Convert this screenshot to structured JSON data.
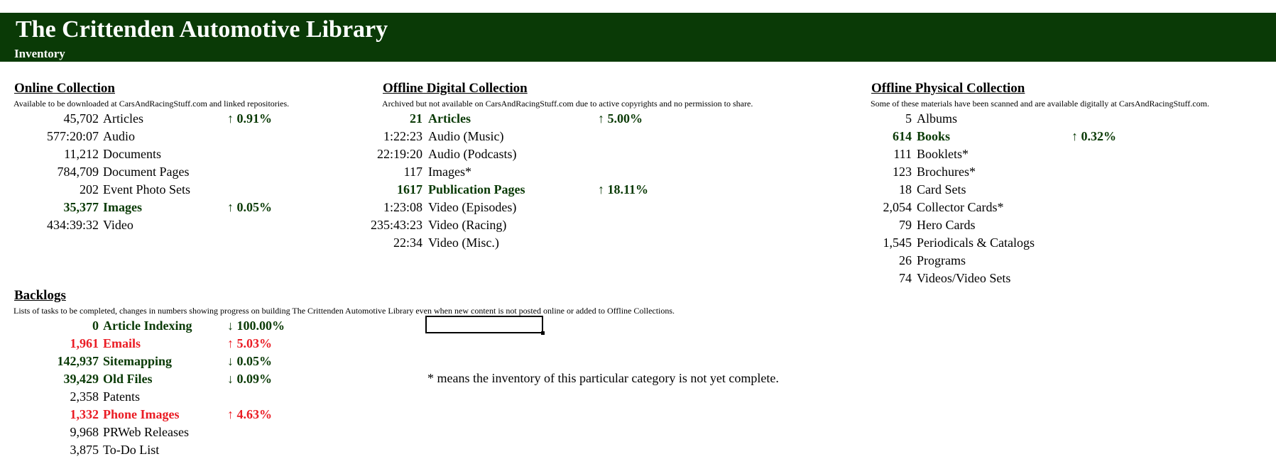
{
  "header": {
    "title": "The Crittenden Automotive Library",
    "subtitle": "Inventory"
  },
  "colors": {
    "banner": "#0a3a06",
    "accent_green": "#0a3a06",
    "alert_red": "#ea1c24"
  },
  "online": {
    "title": "Online Collection",
    "desc": "Available to be downloaded at CarsAndRacingStuff.com and linked repositories.",
    "rows": [
      {
        "num": "45,702",
        "label": "Articles",
        "change": "↑ 0.91%",
        "style": "",
        "change_style": "green"
      },
      {
        "num": "577:20:07",
        "label": "Audio",
        "change": "",
        "style": "",
        "change_style": ""
      },
      {
        "num": "11,212",
        "label": "Documents",
        "change": "",
        "style": "",
        "change_style": ""
      },
      {
        "num": "784,709",
        "label": "Document Pages",
        "change": "",
        "style": "",
        "change_style": ""
      },
      {
        "num": "202",
        "label": "Event Photo Sets",
        "change": "",
        "style": "",
        "change_style": ""
      },
      {
        "num": "35,377",
        "label": "Images",
        "change": "↑ 0.05%",
        "style": "green",
        "change_style": "green"
      },
      {
        "num": "434:39:32",
        "label": "Video",
        "change": "",
        "style": "",
        "change_style": ""
      }
    ]
  },
  "offline_digital": {
    "title": "Offline Digital Collection",
    "desc": "Archived but not available on CarsAndRacingStuff.com due to active copyrights and no permission to share.",
    "rows": [
      {
        "num": "21",
        "label": "Articles",
        "change": "↑ 5.00%",
        "style": "green",
        "change_style": "green"
      },
      {
        "num": "1:22:23",
        "label": "Audio (Music)",
        "change": "",
        "style": "",
        "change_style": ""
      },
      {
        "num": "22:19:20",
        "label": "Audio (Podcasts)",
        "change": "",
        "style": "",
        "change_style": ""
      },
      {
        "num": "117",
        "label": "Images*",
        "change": "",
        "style": "",
        "change_style": ""
      },
      {
        "num": "1617",
        "label": "Publication Pages",
        "change": "↑ 18.11%",
        "style": "green",
        "change_style": "green"
      },
      {
        "num": "1:23:08",
        "label": "Video (Episodes)",
        "change": "",
        "style": "",
        "change_style": ""
      },
      {
        "num": "235:43:23",
        "label": "Video (Racing)",
        "change": "",
        "style": "",
        "change_style": ""
      },
      {
        "num": "22:34",
        "label": "Video (Misc.)",
        "change": "",
        "style": "",
        "change_style": ""
      }
    ]
  },
  "offline_physical": {
    "title": "Offline Physical Collection",
    "desc": "Some of these materials have been scanned and are available digitally at CarsAndRacingStuff.com.",
    "rows": [
      {
        "num": "5",
        "label": "Albums",
        "change": "",
        "style": "",
        "change_style": ""
      },
      {
        "num": "614",
        "label": "Books",
        "change": "↑ 0.32%",
        "style": "green",
        "change_style": "green"
      },
      {
        "num": "111",
        "label": "Booklets*",
        "change": "",
        "style": "",
        "change_style": ""
      },
      {
        "num": "123",
        "label": "Brochures*",
        "change": "",
        "style": "",
        "change_style": ""
      },
      {
        "num": "18",
        "label": "Card Sets",
        "change": "",
        "style": "",
        "change_style": ""
      },
      {
        "num": "2,054",
        "label": "Collector Cards*",
        "change": "",
        "style": "",
        "change_style": ""
      },
      {
        "num": "79",
        "label": "Hero Cards",
        "change": "",
        "style": "",
        "change_style": ""
      },
      {
        "num": "1,545",
        "label": "Periodicals & Catalogs",
        "change": "",
        "style": "",
        "change_style": ""
      },
      {
        "num": "26",
        "label": "Programs",
        "change": "",
        "style": "",
        "change_style": ""
      },
      {
        "num": "74",
        "label": "Videos/Video Sets",
        "change": "",
        "style": "",
        "change_style": ""
      }
    ]
  },
  "backlogs": {
    "title": "Backlogs",
    "desc": "Lists of tasks to be completed, changes in numbers showing progress on building The Crittenden Automotive Library even when new content is not posted online or added to Offline Collections.",
    "rows": [
      {
        "num": "0",
        "label": "Article Indexing",
        "change": "↓ 100.00%",
        "style": "green",
        "change_style": "green"
      },
      {
        "num": "1,961",
        "label": "Emails",
        "change": "↑ 5.03%",
        "style": "red",
        "change_style": "red"
      },
      {
        "num": "142,937",
        "label": "Sitemapping",
        "change": "↓ 0.05%",
        "style": "green",
        "change_style": "green"
      },
      {
        "num": "39,429",
        "label": "Old Files",
        "change": "↓ 0.09%",
        "style": "green",
        "change_style": "green"
      },
      {
        "num": "2,358",
        "label": "Patents",
        "change": "",
        "style": "",
        "change_style": ""
      },
      {
        "num": "1,332",
        "label": "Phone Images",
        "change": "↑ 4.63%",
        "style": "red",
        "change_style": "red"
      },
      {
        "num": "9,968",
        "label": "PRWeb Releases",
        "change": "",
        "style": "",
        "change_style": ""
      },
      {
        "num": "3,875",
        "label": "To-Do List",
        "change": "",
        "style": "",
        "change_style": ""
      }
    ]
  },
  "footnote": "* means the inventory of this particular category is not yet complete."
}
